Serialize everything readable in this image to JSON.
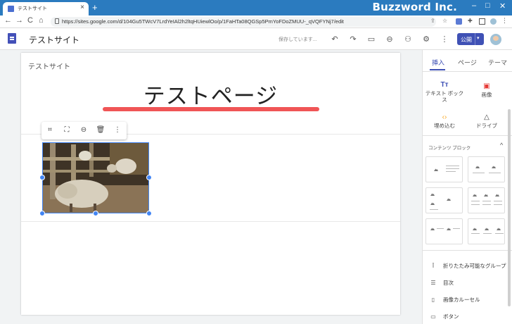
{
  "browser": {
    "tab_title": "テストサイト",
    "tab_close": "×",
    "new_tab": "+",
    "watermark": "Buzzword Inc.",
    "url": "https://sites.google.com/d/104Gu5TWcV7LrdYeIAl2h2ltqHUiewlOo/p/1FaHTa08QGSp5PmYoFDoZMUU-_qVQFYNj7/edit",
    "nav": {
      "back": "←",
      "forward": "→",
      "reload": "C",
      "home": "⌂"
    }
  },
  "toolbar": {
    "site_name": "テストサイト",
    "saving_status": "保存しています...",
    "undo": "↶",
    "redo": "↷",
    "preview": "▭",
    "link": "⊖",
    "share": "⚇",
    "settings": "⚙",
    "more": "⋮",
    "publish_label": "公開",
    "publish_caret": "▾"
  },
  "page": {
    "header_text": "テストサイト",
    "title": "テストページ",
    "underline_color": "#f05556"
  },
  "image_toolbar": {
    "crop": "⌗",
    "fullscreen": "⛶",
    "link": "⊖",
    "delete": "🗑",
    "more": "⋮"
  },
  "sidepanel": {
    "tabs": [
      "挿入",
      "ページ",
      "テーマ"
    ],
    "tools": [
      {
        "label": "テキスト ボックス",
        "icon": "Tт",
        "color": "#3f51b5"
      },
      {
        "label": "画像",
        "icon": "▣",
        "color": "#e53935"
      },
      {
        "label": "埋め込む",
        "icon": "‹›",
        "color": "#f9a825"
      },
      {
        "label": "ドライブ",
        "icon": "△",
        "color": "#444"
      }
    ],
    "content_blocks_label": "コンテンツ ブロック",
    "content_blocks_caret": "^",
    "list_items": [
      {
        "label": "折りたたみ可能なグループ",
        "icon": "Ī"
      },
      {
        "label": "目次",
        "icon": "☰"
      },
      {
        "label": "画像カルーセル",
        "icon": "▯"
      },
      {
        "label": "ボタン",
        "icon": "▭"
      }
    ]
  },
  "colors": {
    "accent": "#3f51b5",
    "chrome_blue": "#2b7bbf",
    "selection": "#4285f4"
  }
}
